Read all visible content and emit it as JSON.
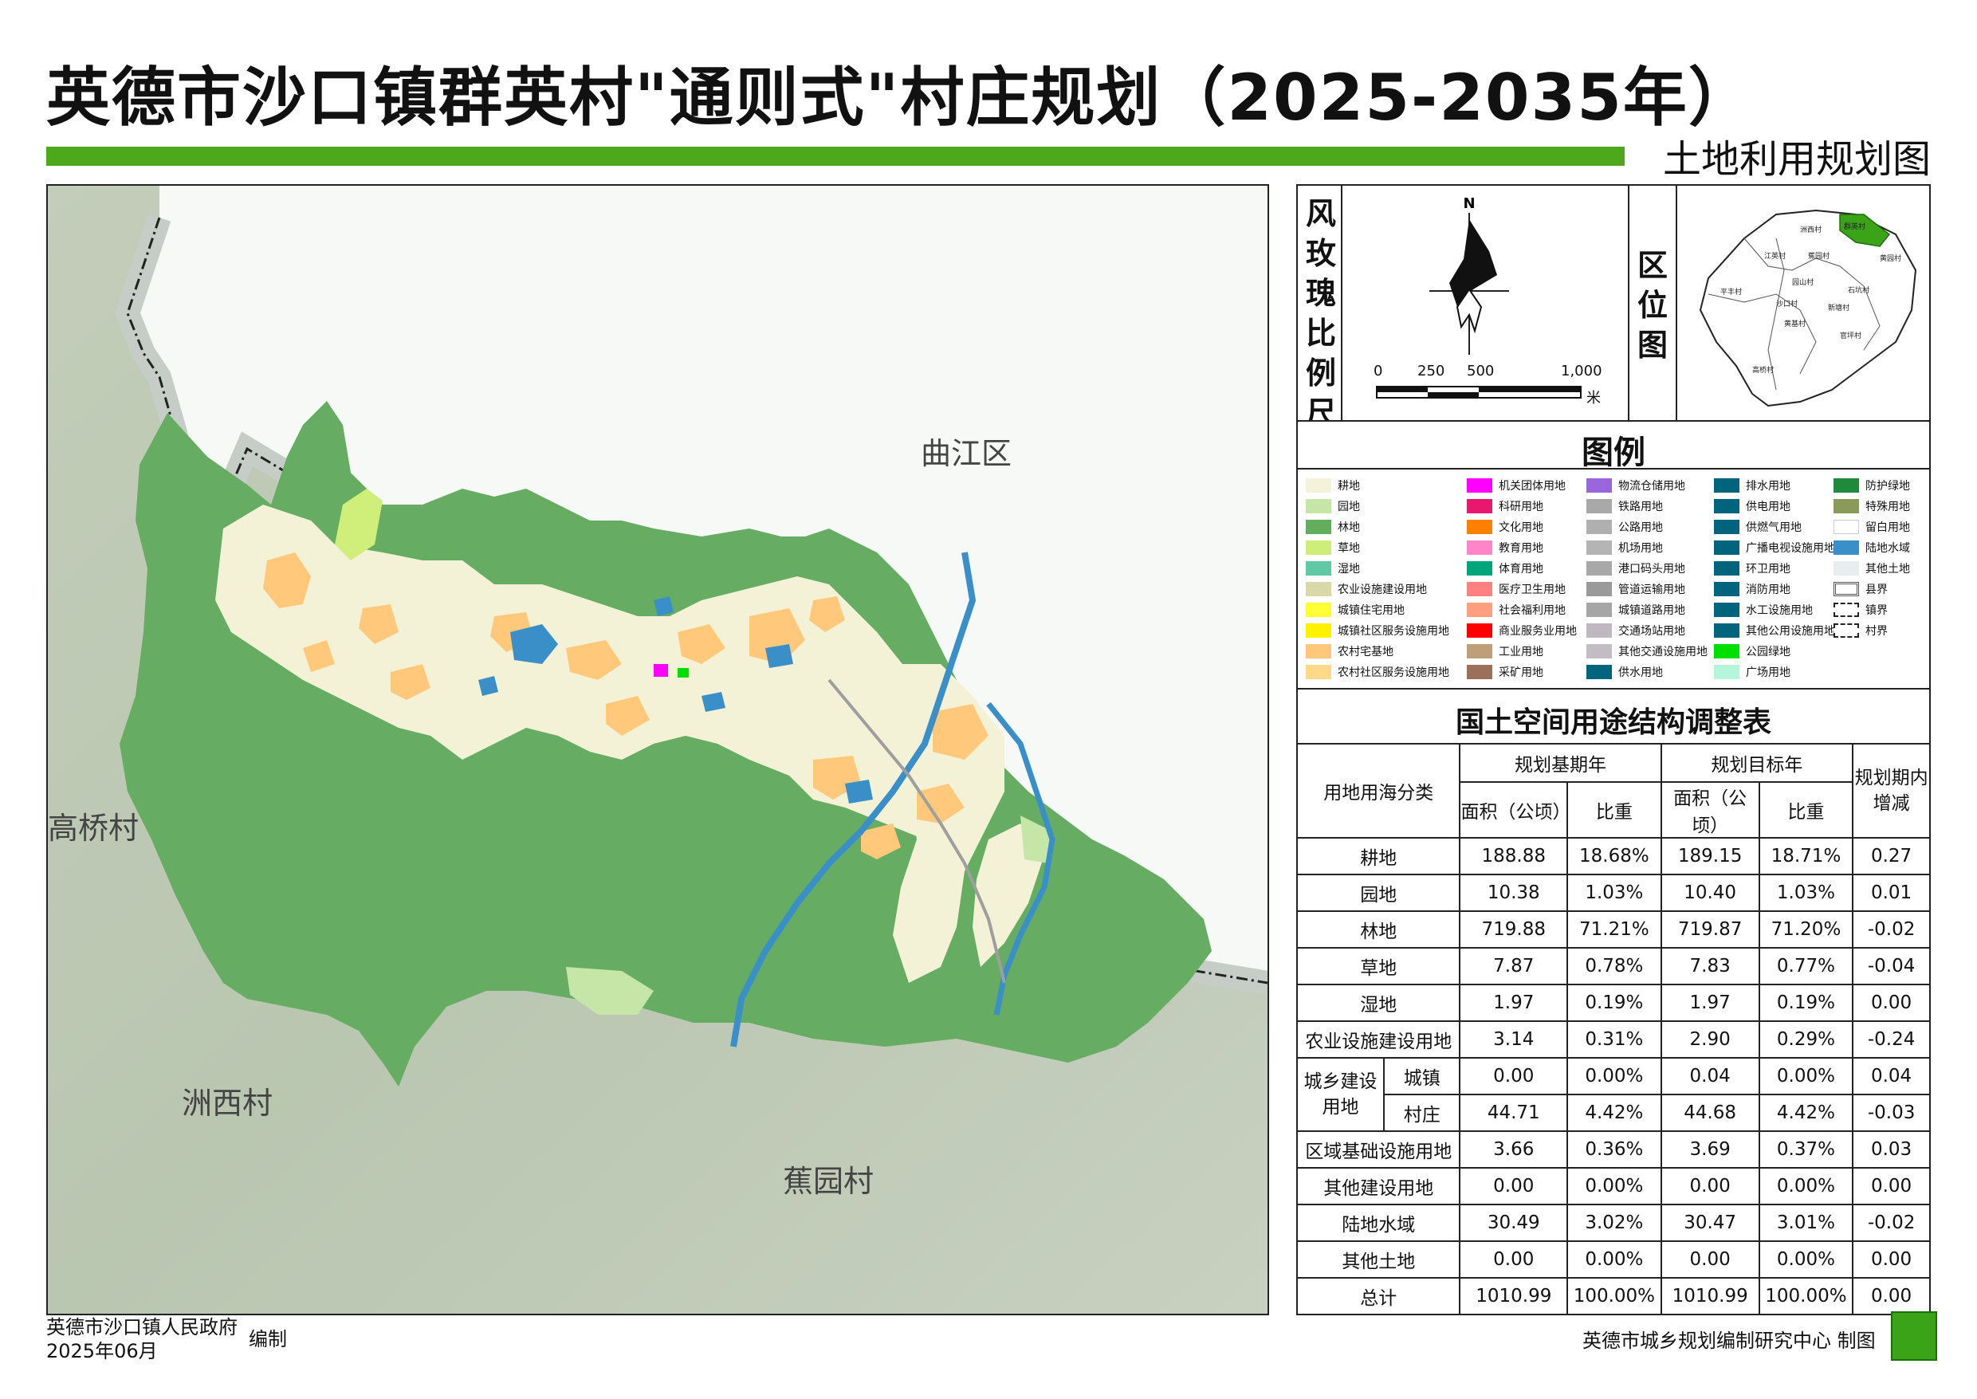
{
  "title": "英德市沙口镇群英村\"通则式\"村庄规划（2025-2035年）",
  "subtitle": "土地利用规划图",
  "map": {
    "place_labels": [
      "曲江区",
      "高桥村",
      "洲西村",
      "蕉园村"
    ]
  },
  "rose": {
    "label": "风玫瑰比例尺",
    "north": "N",
    "scale_ticks": [
      "0",
      "250",
      "500",
      "1,000"
    ],
    "scale_unit": "米"
  },
  "location": {
    "label": "区位图",
    "villages": [
      "群英村",
      "洲西村",
      "蕉园村",
      "江英村",
      "黄园村",
      "园山村",
      "石坑村",
      "平丰村",
      "沙口村",
      "新塘村",
      "黄基村",
      "官坪村",
      "高桥村"
    ]
  },
  "legend": {
    "title": "图例",
    "items": [
      {
        "label": "耕地",
        "color": "#f4f2d8"
      },
      {
        "label": "园地",
        "color": "#c5e6a6"
      },
      {
        "label": "林地",
        "color": "#64ad5f"
      },
      {
        "label": "草地",
        "color": "#cdef7a"
      },
      {
        "label": "湿地",
        "color": "#5fc8a4"
      },
      {
        "label": "农业设施建设用地",
        "color": "#d9d8a8"
      },
      {
        "label": "城镇住宅用地",
        "color": "#ffff33"
      },
      {
        "label": "城镇社区服务设施用地",
        "color": "#fff200"
      },
      {
        "label": "农村宅基地",
        "color": "#ffc87a"
      },
      {
        "label": "农村社区服务设施用地",
        "color": "#ffd98a"
      },
      {
        "label": "机关团体用地",
        "color": "#ff00ff"
      },
      {
        "label": "科研用地",
        "color": "#e6196e"
      },
      {
        "label": "文化用地",
        "color": "#ff7f00"
      },
      {
        "label": "教育用地",
        "color": "#ff85c8"
      },
      {
        "label": "体育用地",
        "color": "#00a57a"
      },
      {
        "label": "医疗卫生用地",
        "color": "#ff8080"
      },
      {
        "label": "社会福利用地",
        "color": "#ff9f80"
      },
      {
        "label": "商业服务业用地",
        "color": "#ff0000"
      },
      {
        "label": "工业用地",
        "color": "#bf9f7a"
      },
      {
        "label": "采矿用地",
        "color": "#9c6f5a"
      },
      {
        "label": "物流仓储用地",
        "color": "#9966dd"
      },
      {
        "label": "铁路用地",
        "color": "#a9a9a9"
      },
      {
        "label": "公路用地",
        "color": "#b0b0b0"
      },
      {
        "label": "机场用地",
        "color": "#b4b4b4"
      },
      {
        "label": "港口码头用地",
        "color": "#a8a8a8"
      },
      {
        "label": "管道运输用地",
        "color": "#9a9a9a"
      },
      {
        "label": "城镇道路用地",
        "color": "#a6a6a6"
      },
      {
        "label": "交通场站用地",
        "color": "#c0b8c0"
      },
      {
        "label": "其他交通设施用地",
        "color": "#c4bcc4"
      },
      {
        "label": "供水用地",
        "color": "#00647c"
      },
      {
        "label": "排水用地",
        "color": "#00647c"
      },
      {
        "label": "供电用地",
        "color": "#00647c"
      },
      {
        "label": "供燃气用地",
        "color": "#00647c"
      },
      {
        "label": "广播电视设施用地",
        "color": "#00647c"
      },
      {
        "label": "环卫用地",
        "color": "#00647c"
      },
      {
        "label": "消防用地",
        "color": "#00647c"
      },
      {
        "label": "水工设施用地",
        "color": "#00647c"
      },
      {
        "label": "其他公用设施用地",
        "color": "#00647c"
      },
      {
        "label": "公园绿地",
        "color": "#00e000"
      },
      {
        "label": "广场用地",
        "color": "#b4f5dc"
      },
      {
        "label": "防护绿地",
        "color": "#1f8a3c"
      },
      {
        "label": "特殊用地",
        "color": "#8a9a5a"
      },
      {
        "label": "留白用地",
        "color": "#ffffff"
      },
      {
        "label": "陆地水域",
        "color": "#3a8fc8"
      },
      {
        "label": "其他土地",
        "color": "#e8eef0"
      },
      {
        "label": "县界",
        "color": "#888888"
      },
      {
        "label": "镇界",
        "color": "#ffffff"
      },
      {
        "label": "村界",
        "color": "#ffffff"
      }
    ]
  },
  "table": {
    "title": "国土空间用途结构调整表",
    "header": {
      "category": "用地用海分类",
      "base_year": "规划基期年",
      "target_year": "规划目标年",
      "change": "规划期内增减",
      "area": "面积（公顷）",
      "share": "比重"
    },
    "group_label": "城乡建设用地",
    "rows": [
      {
        "name": "耕地",
        "base_area": "188.88",
        "base_share": "18.68%",
        "target_area": "189.15",
        "target_share": "18.71%",
        "change": "0.27"
      },
      {
        "name": "园地",
        "base_area": "10.38",
        "base_share": "1.03%",
        "target_area": "10.40",
        "target_share": "1.03%",
        "change": "0.01"
      },
      {
        "name": "林地",
        "base_area": "719.88",
        "base_share": "71.21%",
        "target_area": "719.87",
        "target_share": "71.20%",
        "change": "-0.02"
      },
      {
        "name": "草地",
        "base_area": "7.87",
        "base_share": "0.78%",
        "target_area": "7.83",
        "target_share": "0.77%",
        "change": "-0.04"
      },
      {
        "name": "湿地",
        "base_area": "1.97",
        "base_share": "0.19%",
        "target_area": "1.97",
        "target_share": "0.19%",
        "change": "0.00"
      },
      {
        "name": "农业设施建设用地",
        "base_area": "3.14",
        "base_share": "0.31%",
        "target_area": "2.90",
        "target_share": "0.29%",
        "change": "-0.24"
      },
      {
        "name": "城镇",
        "base_area": "0.00",
        "base_share": "0.00%",
        "target_area": "0.04",
        "target_share": "0.00%",
        "change": "0.04"
      },
      {
        "name": "村庄",
        "base_area": "44.71",
        "base_share": "4.42%",
        "target_area": "44.68",
        "target_share": "4.42%",
        "change": "-0.03"
      },
      {
        "name": "区域基础设施用地",
        "base_area": "3.66",
        "base_share": "0.36%",
        "target_area": "3.69",
        "target_share": "0.37%",
        "change": "0.03"
      },
      {
        "name": "其他建设用地",
        "base_area": "0.00",
        "base_share": "0.00%",
        "target_area": "0.00",
        "target_share": "0.00%",
        "change": "0.00"
      },
      {
        "name": "陆地水域",
        "base_area": "30.49",
        "base_share": "3.02%",
        "target_area": "30.47",
        "target_share": "3.01%",
        "change": "-0.02"
      },
      {
        "name": "其他土地",
        "base_area": "0.00",
        "base_share": "0.00%",
        "target_area": "0.00",
        "target_share": "0.00%",
        "change": "0.00"
      },
      {
        "name": "总计",
        "base_area": "1010.99",
        "base_share": "100.00%",
        "target_area": "1010.99",
        "target_share": "100.00%",
        "change": "0.00"
      }
    ]
  },
  "footer": {
    "org": "英德市沙口镇人民政府",
    "date": "2025年06月",
    "edit": "编制",
    "maker": "英德市城乡规划编制研究中心 制图"
  }
}
